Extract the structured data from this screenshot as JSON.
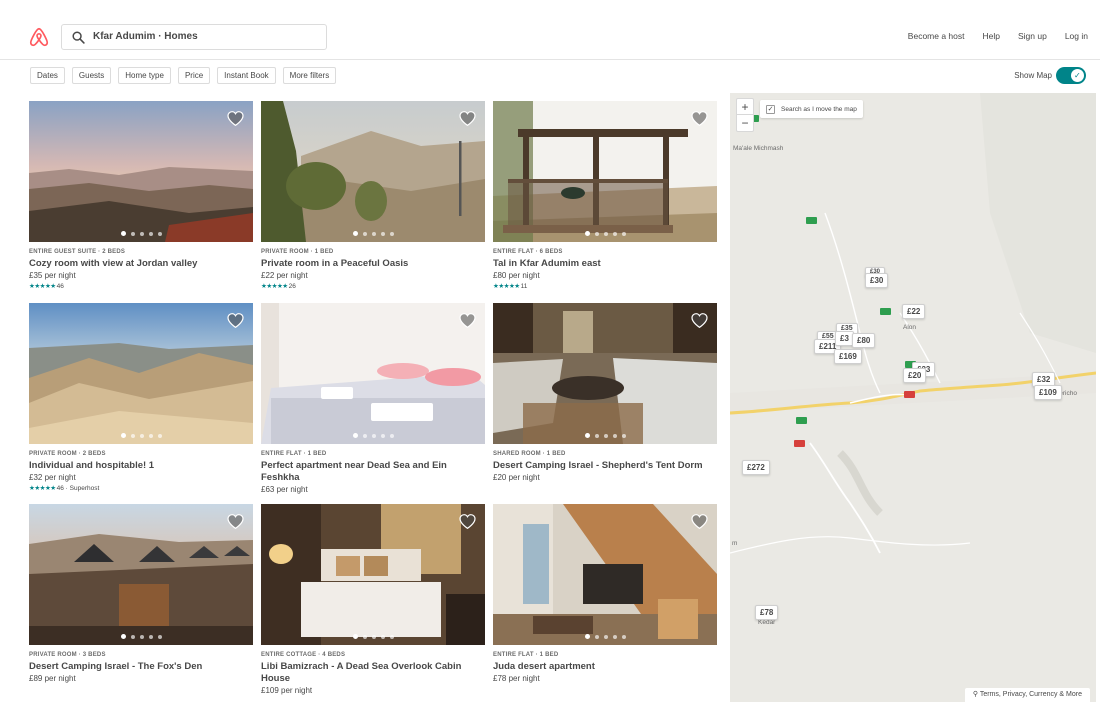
{
  "header": {
    "search_value": "Kfar Adumim · Homes",
    "nav": [
      "Become a host",
      "Help",
      "Sign up",
      "Log in"
    ]
  },
  "filters": {
    "buttons": [
      "Dates",
      "Guests",
      "Home type",
      "Price",
      "Instant Book",
      "More filters"
    ],
    "show_map_label": "Show Map",
    "show_map_on": true
  },
  "listings": [
    {
      "kind": "ENTIRE GUEST SUITE · 2 BEDS",
      "title": "Cozy room with view at Jordan valley",
      "price": "£35 per night",
      "stars": "★★★★★",
      "reviews": "46"
    },
    {
      "kind": "PRIVATE ROOM · 1 BED",
      "title": "Private room in a Peaceful Oasis",
      "price": "£22 per night",
      "stars": "★★★★★",
      "reviews": "26"
    },
    {
      "kind": "ENTIRE FLAT · 6 BEDS",
      "title": "Tal in Kfar Adumim east",
      "price": "£80 per night",
      "stars": "★★★★★",
      "reviews": "11"
    },
    {
      "kind": "PRIVATE ROOM · 2 BEDS",
      "title": "Individual and hospitable! 1",
      "price": "£32 per night",
      "stars": "★★★★★",
      "reviews": "46 · Superhost"
    },
    {
      "kind": "ENTIRE FLAT · 1 BED",
      "title": "Perfect apartment near Dead Sea and Ein Feshkha",
      "price": "£63 per night"
    },
    {
      "kind": "SHARED ROOM · 1 BED",
      "title": "Desert Camping Israel - Shepherd's Tent Dorm",
      "price": "£20 per night"
    },
    {
      "kind": "PRIVATE ROOM · 3 BEDS",
      "title": "Desert Camping Israel - The Fox's Den",
      "price": "£89 per night"
    },
    {
      "kind": "ENTIRE COTTAGE · 4 BEDS",
      "title": "Libi Bamizrach - A Dead Sea Overlook Cabin House",
      "price": "£109 per night"
    },
    {
      "kind": "ENTIRE FLAT · 1 BED",
      "title": "Juda desert apartment",
      "price": "£78 per night"
    }
  ],
  "map": {
    "zoom_in": "+",
    "zoom_out": "−",
    "move_label": "Search as I move the map",
    "move_checked": true,
    "pins": [
      "£30",
      "£22",
      "£35",
      "£3",
      "£80",
      "£169",
      "£211",
      "£20",
      "£32",
      "£109",
      "£272",
      "£78",
      "£55",
      "£23"
    ],
    "places": [
      "Ma'ale Michmash",
      "Alon",
      "Kedar",
      "Jericho",
      "m"
    ],
    "terms": "Terms, Privacy, Currency & More"
  },
  "colors": {
    "brand": "#FF5A5F",
    "accent": "#008489",
    "text": "#484848"
  }
}
